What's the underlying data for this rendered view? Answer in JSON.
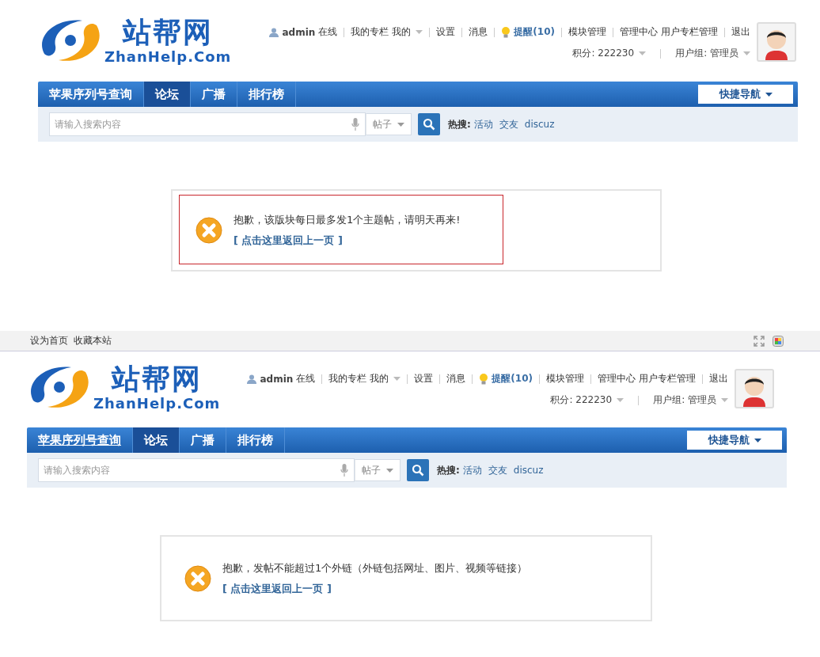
{
  "screens": [
    {
      "logo": {
        "name": "站帮网",
        "domain": "ZhanHelp.Com"
      },
      "user_links": [
        [
          {
            "text": "admin",
            "kind": "user"
          },
          {
            "text": "在线",
            "kind": "plain"
          }
        ],
        [
          {
            "text": "我的专栏",
            "kind": "plain"
          },
          {
            "text": "我的",
            "kind": "menu"
          }
        ],
        [
          {
            "text": "设置",
            "kind": "plain"
          }
        ],
        [
          {
            "text": "消息",
            "kind": "plain"
          }
        ],
        [
          {
            "text": "提醒(10)",
            "kind": "alert"
          }
        ],
        [
          {
            "text": "模块管理",
            "kind": "plain"
          }
        ],
        [
          {
            "text": "管理中心",
            "kind": "plain"
          },
          {
            "text": "用户专栏管理",
            "kind": "plain"
          }
        ],
        [
          {
            "text": "退出",
            "kind": "plain"
          }
        ]
      ],
      "user_info": [
        {
          "text": "积分: 222230"
        },
        {
          "text": "用户组: 管理员"
        }
      ],
      "nav": [
        {
          "label": "苹果序列号查询",
          "selected": false,
          "hovered": false
        },
        {
          "label": "论坛",
          "selected": true,
          "hovered": false
        },
        {
          "label": "广播",
          "selected": false,
          "hovered": false
        },
        {
          "label": "排行榜",
          "selected": false,
          "hovered": false
        }
      ],
      "quick_nav": "快捷导航",
      "search": {
        "placeholder": "请输入搜索内容",
        "scope": "帖子",
        "hot_label": "热搜:",
        "hot": [
          "活动",
          "交友",
          "discuz"
        ]
      },
      "message": {
        "text": "抱歉，该版块每日最多发1个主题帖，请明天再来!",
        "back_link": "[ 点击这里返回上一页 ]",
        "highlighted": true
      }
    },
    {
      "top_bar": {
        "links": [
          "设为首页",
          "收藏本站"
        ]
      },
      "logo": {
        "name": "站帮网",
        "domain": "ZhanHelp.Com"
      },
      "user_links": [
        [
          {
            "text": "admin",
            "kind": "user"
          },
          {
            "text": "在线",
            "kind": "plain"
          }
        ],
        [
          {
            "text": "我的专栏",
            "kind": "plain"
          },
          {
            "text": "我的",
            "kind": "menu"
          }
        ],
        [
          {
            "text": "设置",
            "kind": "plain"
          }
        ],
        [
          {
            "text": "消息",
            "kind": "plain"
          }
        ],
        [
          {
            "text": "提醒(10)",
            "kind": "alert"
          }
        ],
        [
          {
            "text": "模块管理",
            "kind": "plain"
          }
        ],
        [
          {
            "text": "管理中心",
            "kind": "plain"
          },
          {
            "text": "用户专栏管理",
            "kind": "plain"
          }
        ],
        [
          {
            "text": "退出",
            "kind": "plain"
          }
        ]
      ],
      "user_info": [
        {
          "text": "积分: 222230"
        },
        {
          "text": "用户组: 管理员"
        }
      ],
      "nav": [
        {
          "label": "苹果序列号查询",
          "selected": false,
          "hovered": true
        },
        {
          "label": "论坛",
          "selected": true,
          "hovered": false
        },
        {
          "label": "广播",
          "selected": false,
          "hovered": false
        },
        {
          "label": "排行榜",
          "selected": false,
          "hovered": false
        }
      ],
      "quick_nav": "快捷导航",
      "search": {
        "placeholder": "请输入搜索内容",
        "scope": "帖子",
        "hot_label": "热搜:",
        "hot": [
          "活动",
          "交友",
          "discuz"
        ]
      },
      "message": {
        "text": "抱歉，发帖不能超过1个外链（外链包括网址、图片、视频等链接）",
        "back_link": "[ 点击这里返回上一页 ]",
        "highlighted": false
      }
    }
  ]
}
